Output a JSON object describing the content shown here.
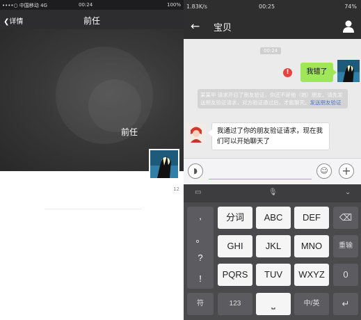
{
  "left_screen": {
    "status_bar": {
      "carrier": "••••○ 中国移动  4G",
      "time": "00:24",
      "battery": "100%"
    },
    "nav": {
      "back_label": "详情",
      "title": "前任"
    },
    "hero_caption": "前任",
    "count": "12"
  },
  "right_screen": {
    "status_bar": {
      "network": "1.83K/s",
      "time": "00:25",
      "battery": "74%"
    },
    "nav": {
      "title": "宝贝"
    },
    "chat": {
      "timestamp": "00:24",
      "my_message": "我错了",
      "system_text": "某某甲 请求开启了朋友验证，你还不是他（她）朋友。请先发送朋友验证请求，对方验证通过后，才能聊天。",
      "system_link": "发送朋友验证",
      "peer_message": "我通过了你的朋友验证请求，现在我们可以开始聊天了"
    },
    "input": {
      "value": "",
      "placeholder": ""
    },
    "keyboard": {
      "symbols": [
        ",",
        "。",
        "?",
        "!"
      ],
      "rows": [
        [
          "分词",
          "ABC",
          "DEF"
        ],
        [
          "GHI",
          "JKL",
          "MNO"
        ],
        [
          "PQRS",
          "TUV",
          "WXYZ"
        ]
      ],
      "right_keys": [
        "⌫",
        "重输",
        "0"
      ],
      "bottom": {
        "sym": "符",
        "num": "123",
        "space": "⎵",
        "lang": "中/英",
        "enter": "↵"
      }
    }
  },
  "colors": {
    "my_bubble": "#9fe658",
    "dark_bar": "#2e2e2e",
    "link": "#4e74c6",
    "error": "#e64340"
  }
}
